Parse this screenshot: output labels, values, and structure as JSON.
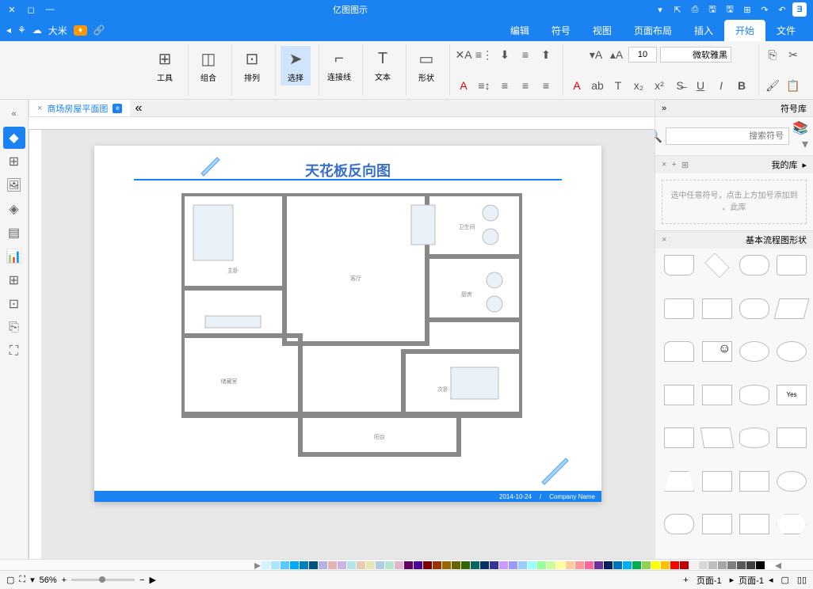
{
  "titlebar": {
    "app_title": "亿图图示"
  },
  "menubar": {
    "tabs": [
      "文件",
      "开始",
      "插入",
      "页面布局",
      "视图",
      "符号",
      "编辑"
    ],
    "active_tab": 1,
    "user_name": "大米"
  },
  "ribbon": {
    "font_name": "微软雅黑",
    "font_size": "10",
    "tool_labels": {
      "select": "选择",
      "connector": "连接线",
      "text": "文本",
      "shapes": "形状",
      "align": "排列",
      "group": "组合",
      "tools": "工具"
    }
  },
  "doc_tab": {
    "name": "商场房屋平面图"
  },
  "canvas": {
    "page_title": "天花板反向图",
    "footer_company": "Company Name",
    "footer_date": "2014-10-24",
    "rooms": {
      "living": "客厅",
      "master_bed": "主卧",
      "second_bed": "次卧",
      "bathroom": "卫生间",
      "kitchen": "厨房",
      "storage": "储藏室",
      "balcony": "阳台"
    }
  },
  "right_panel": {
    "title": "符号库",
    "search_placeholder": "搜索符号",
    "my_lib": "我的库",
    "my_lib_hint": "选中任意符号，点击上方加号添加到此库。",
    "shapes_title": "基本流程图形状"
  },
  "colorbar": {
    "colors": [
      "#ffffff",
      "#000000",
      "#404040",
      "#595959",
      "#7f7f7f",
      "#a6a6a6",
      "#bfbfbf",
      "#d9d9d9",
      "#f2f2f2",
      "#c00000",
      "#ff0000",
      "#ffc000",
      "#ffff00",
      "#92d050",
      "#00b050",
      "#00b0f0",
      "#0070c0",
      "#002060",
      "#7030a0",
      "#ff6699",
      "#ff9999",
      "#ffcc99",
      "#ffff99",
      "#ccff99",
      "#99ff99",
      "#99ffff",
      "#99ccff",
      "#9999ff",
      "#cc99ff",
      "#333399",
      "#003366",
      "#006666",
      "#336600",
      "#666600",
      "#996600",
      "#993300",
      "#800000",
      "#4d0099",
      "#660066",
      "#e6b3cc",
      "#b3e6cc",
      "#b3cce6",
      "#e6e6b3",
      "#e6ccb3",
      "#b3e6e6",
      "#ccb3e6",
      "#e6b3b3",
      "#b3b3e6",
      "#005580",
      "#0080c0",
      "#00aaff",
      "#55ccff",
      "#aae6ff",
      "#d5f2ff"
    ]
  },
  "statusbar": {
    "page_label_1": "页面-1",
    "page_label_2": "页面-1",
    "zoom_value": "56%"
  }
}
